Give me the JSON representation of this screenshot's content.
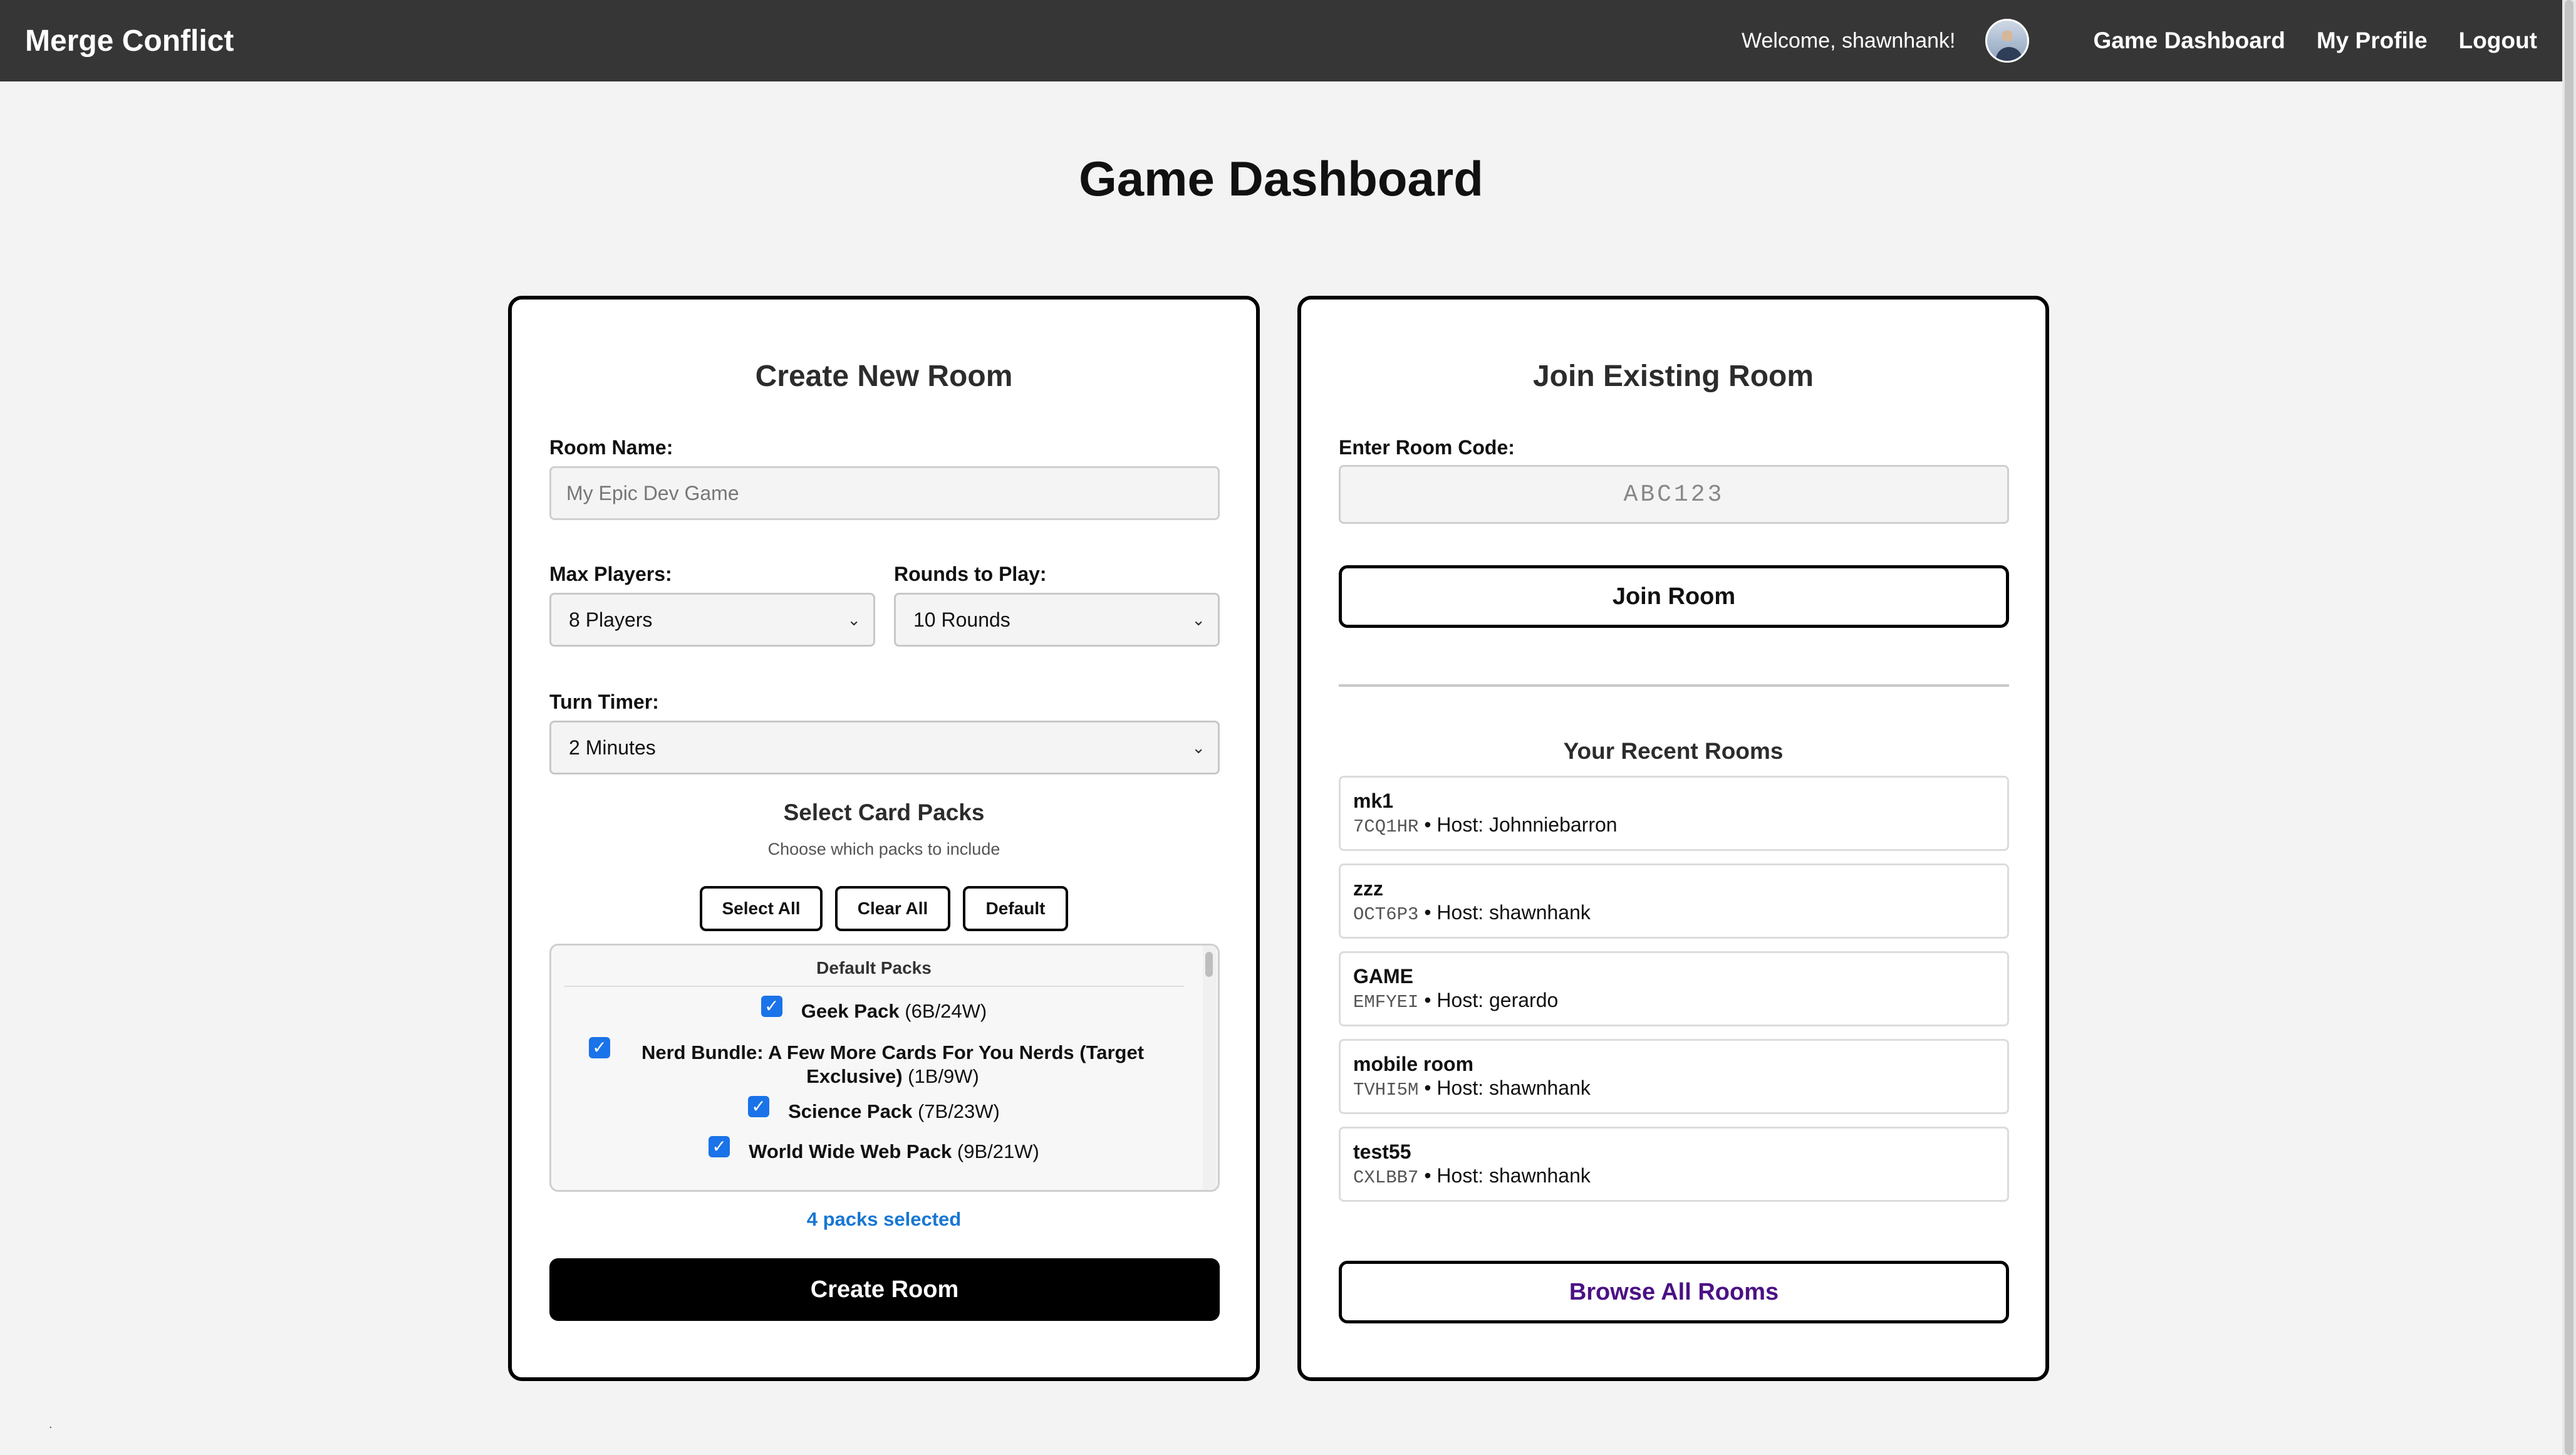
{
  "nav": {
    "brand": "Merge Conflict",
    "welcome": "Welcome, shawnhank!",
    "links": [
      "Game Dashboard",
      "My Profile",
      "Logout"
    ]
  },
  "page": {
    "title": "Game Dashboard"
  },
  "create": {
    "title": "Create New Room",
    "room_name_label": "Room Name:",
    "room_name_placeholder": "My Epic Dev Game",
    "max_players_label": "Max Players:",
    "max_players_value": "8 Players",
    "rounds_label": "Rounds to Play:",
    "rounds_value": "10 Rounds",
    "turn_timer_label": "Turn Timer:",
    "turn_timer_value": "2 Minutes",
    "packs_title": "Select Card Packs",
    "packs_sub": "Choose which packs to include",
    "btn_select_all": "Select All",
    "btn_clear_all": "Clear All",
    "btn_default": "Default",
    "packs_group": "Default Packs",
    "packs": [
      {
        "name": "Geek Pack",
        "counts": "(6B/24W)",
        "checked": true
      },
      {
        "name": "Nerd Bundle: A Few More Cards For You Nerds (Target Exclusive)",
        "counts": "(1B/9W)",
        "checked": true
      },
      {
        "name": "Science Pack",
        "counts": "(7B/23W)",
        "checked": true
      },
      {
        "name": "World Wide Web Pack",
        "counts": "(9B/21W)",
        "checked": true
      }
    ],
    "packs_selected": "4 packs selected",
    "create_button": "Create Room"
  },
  "join": {
    "title": "Join Existing Room",
    "code_label": "Enter Room Code:",
    "code_placeholder": "ABC123",
    "join_button": "Join Room",
    "recent_title": "Your Recent Rooms",
    "rooms": [
      {
        "name": "mk1",
        "code": "7CQ1HR",
        "host": "• Host: Johnniebarron"
      },
      {
        "name": "zzz",
        "code": "OCT6P3",
        "host": "• Host: shawnhank"
      },
      {
        "name": "GAME",
        "code": "EMFYEI",
        "host": "• Host: gerardo"
      },
      {
        "name": "mobile room",
        "code": "TVHI5M",
        "host": "• Host: shawnhank"
      },
      {
        "name": "test55",
        "code": "CXLBB7",
        "host": "• Host: shawnhank"
      }
    ],
    "browse_button": "Browse All Rooms"
  },
  "icons": {
    "checkbox": "checkbox-checked-icon",
    "select": "chevron-down-icon"
  },
  "colors": {
    "nav_bg": "#363636",
    "accent_blue": "#1877d2",
    "browse_purple": "#4b1184"
  }
}
